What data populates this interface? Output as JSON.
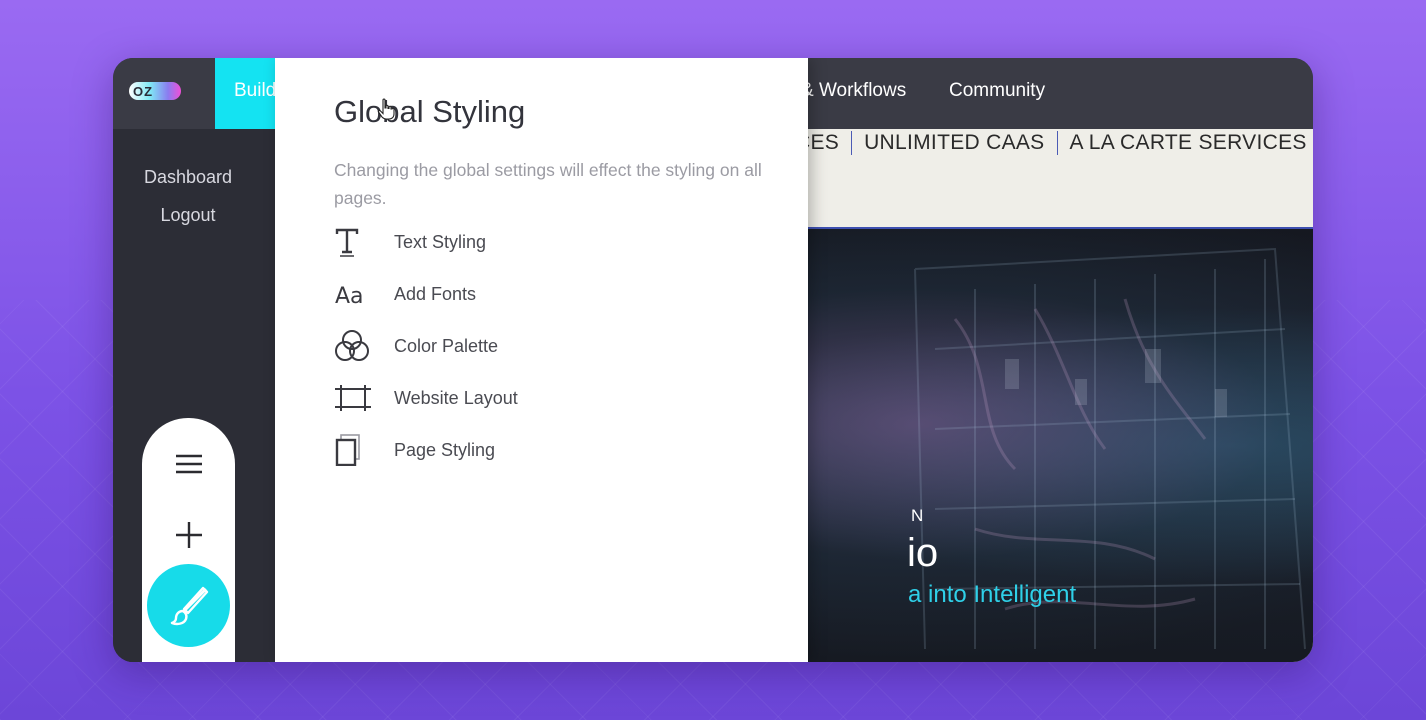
{
  "brand": {
    "logo_text": "OZ"
  },
  "topnav": {
    "build_label": "Build",
    "items": [
      {
        "label": "& Workflows"
      },
      {
        "label": "Community"
      }
    ]
  },
  "sidebar": {
    "links": [
      {
        "label": "Dashboard"
      },
      {
        "label": "Logout"
      }
    ],
    "tools": [
      {
        "icon": "hamburger-menu-icon"
      },
      {
        "icon": "plus-icon"
      },
      {
        "icon": "paintbrush-icon",
        "active": true
      },
      {
        "icon": "filter-icon"
      },
      {
        "icon": "gear-icon"
      }
    ]
  },
  "preview": {
    "submenu": [
      {
        "label": "CES"
      },
      {
        "label": "UNLIMITED CAAS"
      },
      {
        "label": "A LA CARTE SERVICES"
      }
    ],
    "hero": {
      "eyebrow": "N",
      "heading": "io",
      "tagline": "a into Intelligent"
    }
  },
  "panel": {
    "title": "Global Styling",
    "description": "Changing the global settings will effect the styling on all pages.",
    "options": [
      {
        "label": "Text Styling",
        "icon": "text-t-icon"
      },
      {
        "label": "Add Fonts",
        "icon": "font-aa-icon"
      },
      {
        "label": "Color Palette",
        "icon": "color-circles-icon"
      },
      {
        "label": "Website Layout",
        "icon": "layout-icon"
      },
      {
        "label": "Page Styling",
        "icon": "page-icon"
      }
    ]
  },
  "colors": {
    "accent_cyan": "#14e3f2",
    "topbar": "#3a3b45",
    "sidebar": "#2c2d36",
    "background_purple": "#8b5cf0"
  }
}
